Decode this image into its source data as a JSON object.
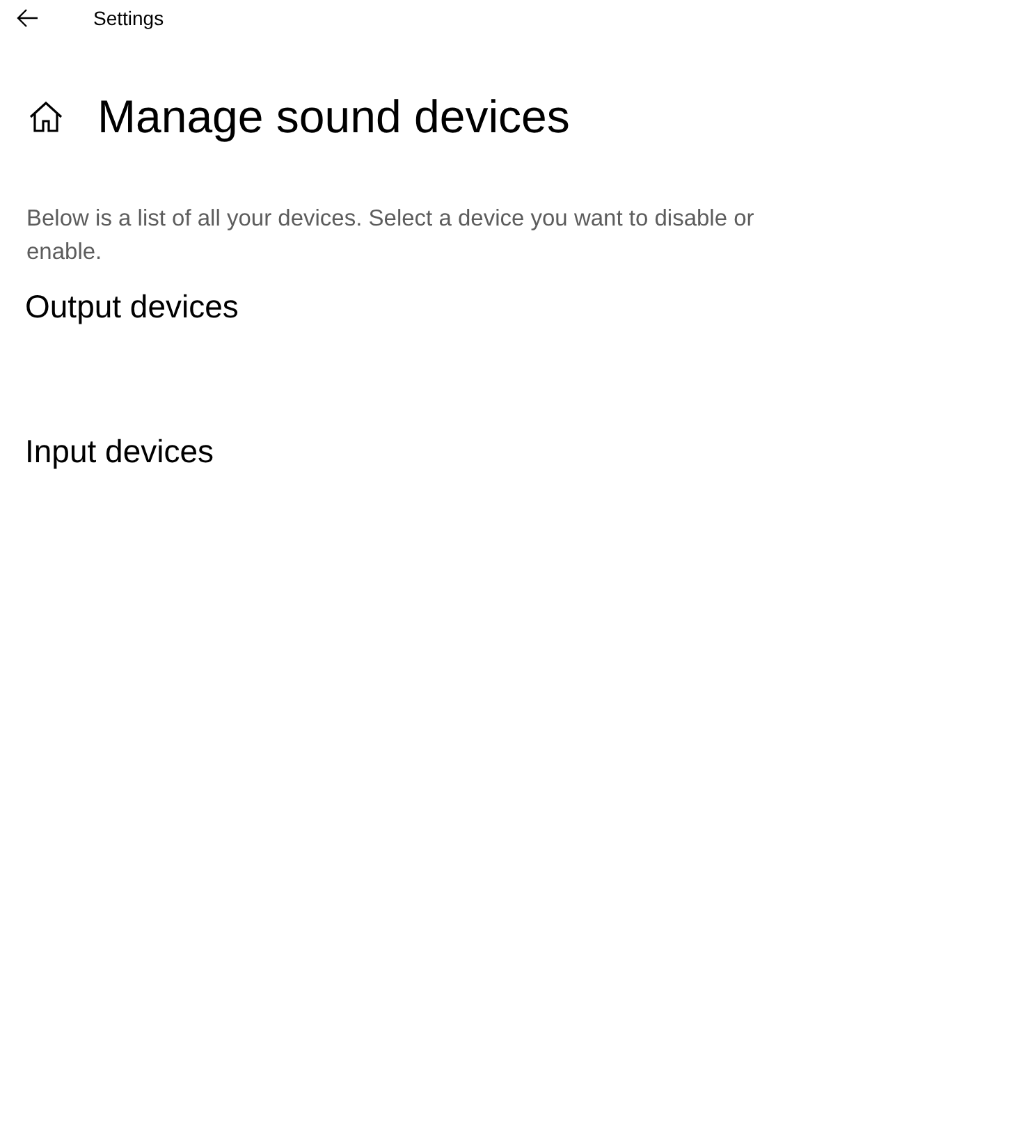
{
  "window": {
    "title": "Settings"
  },
  "page": {
    "title": "Manage sound devices",
    "description": "Below is a list of all your devices. Select a device you want to disable or enable."
  },
  "sections": [
    {
      "title": "Output devices"
    },
    {
      "title": "Input devices"
    }
  ]
}
